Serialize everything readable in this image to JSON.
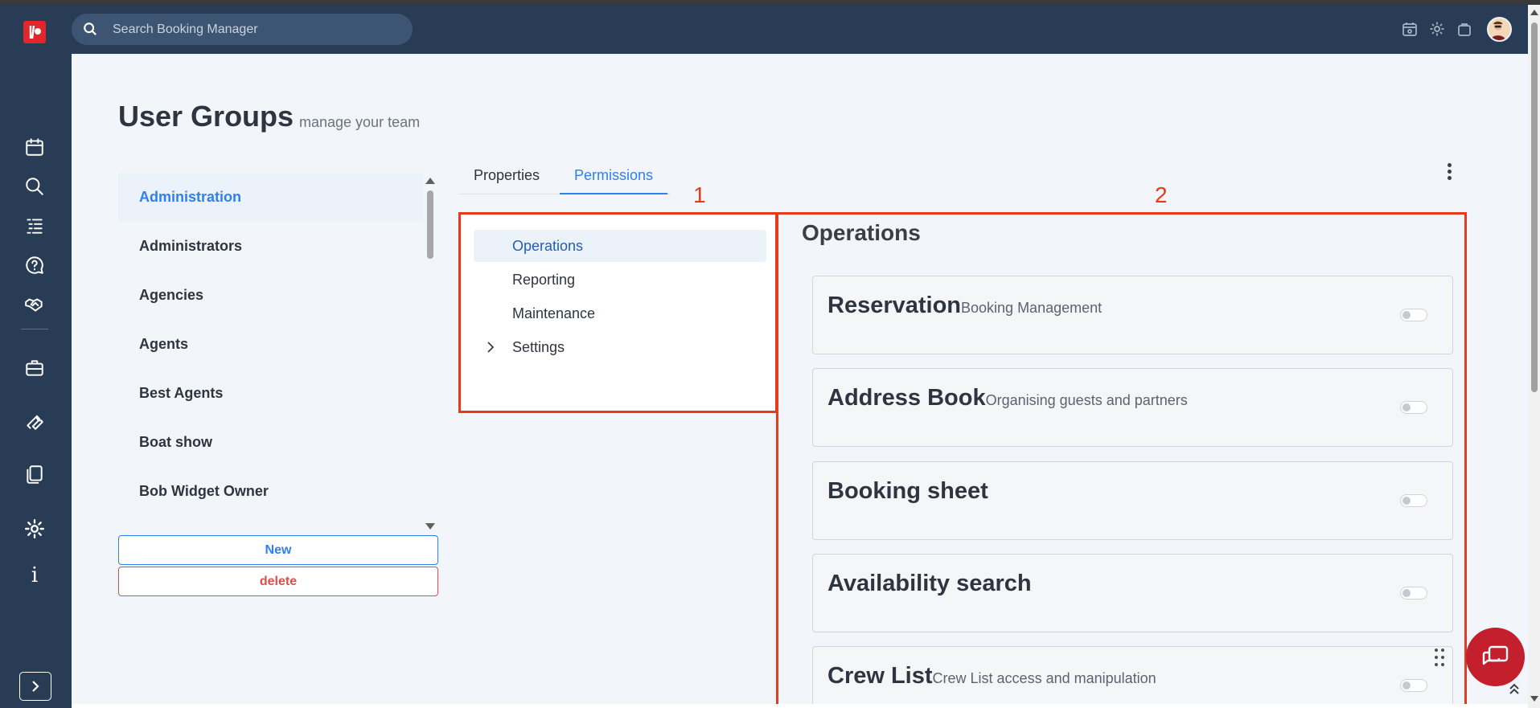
{
  "header": {
    "search_placeholder": "Search Booking Manager"
  },
  "page": {
    "title": "User Groups",
    "subtitle": "manage your team"
  },
  "groups": {
    "items": [
      {
        "label": "Administration",
        "active": true
      },
      {
        "label": "Administrators"
      },
      {
        "label": "Agencies"
      },
      {
        "label": "Agents"
      },
      {
        "label": "Best Agents"
      },
      {
        "label": "Boat show"
      },
      {
        "label": "Bob Widget Owner"
      }
    ],
    "new_label": "New",
    "delete_label": "delete"
  },
  "tabs": [
    {
      "label": "Properties"
    },
    {
      "label": "Permissions",
      "active": true
    }
  ],
  "annotations": {
    "label_1": "1",
    "label_2": "2"
  },
  "tree": {
    "items": [
      {
        "label": "Operations",
        "active": true
      },
      {
        "label": "Reporting"
      },
      {
        "label": "Maintenance"
      },
      {
        "label": "Settings",
        "expandable": true
      }
    ]
  },
  "panel": {
    "title": "Operations",
    "cards": [
      {
        "name": "Reservation",
        "description": "Booking Management",
        "enabled": false
      },
      {
        "name": "Address Book",
        "description": "Organising guests and partners",
        "enabled": false
      },
      {
        "name": "Booking sheet",
        "description": "",
        "enabled": false
      },
      {
        "name": "Availability search",
        "description": "",
        "enabled": false
      },
      {
        "name": "Crew List",
        "description": "Crew List access and manipulation",
        "enabled": false
      }
    ]
  },
  "icons": {
    "sidebar": [
      "calendar-icon",
      "search-icon",
      "list-icon",
      "help-chat-icon",
      "handshake-icon",
      "briefcase-icon",
      "wrench-icon",
      "documents-icon",
      "gear-icon",
      "info-icon"
    ],
    "header": [
      "calendar-settings-icon",
      "gear-icon",
      "bag-icon",
      "avatar"
    ]
  },
  "colors": {
    "sidebar_bg": "#283c55",
    "accent": "#2f80ed",
    "danger": "#e24b4b",
    "annotation": "#e8391e",
    "chat_fab": "#c41f2d"
  }
}
